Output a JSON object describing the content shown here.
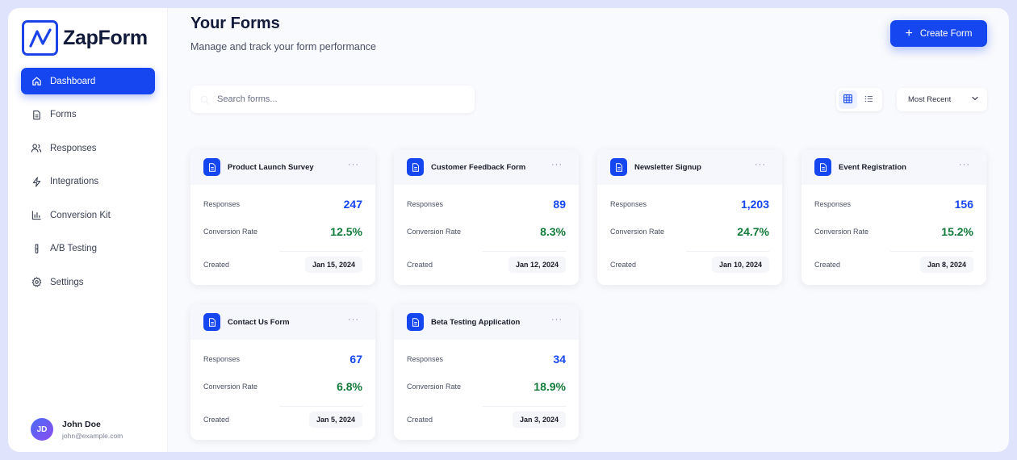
{
  "app": {
    "name": "ZapForm"
  },
  "nav": {
    "items": [
      {
        "label": "Dashboard",
        "icon": "home-icon",
        "active": true
      },
      {
        "label": "Forms",
        "icon": "file-icon"
      },
      {
        "label": "Responses",
        "icon": "users-icon"
      },
      {
        "label": "Integrations",
        "icon": "lightning-icon"
      },
      {
        "label": "Conversion Kit",
        "icon": "bar-chart-icon"
      },
      {
        "label": "A/B Testing",
        "icon": "test-tube-icon"
      },
      {
        "label": "Settings",
        "icon": "gear-icon"
      }
    ]
  },
  "user": {
    "initials": "JD",
    "name": "John Doe",
    "email": "john@example.com"
  },
  "header": {
    "title": "Your Forms",
    "subtitle": "Manage and track your form performance",
    "create_button": "Create Form"
  },
  "toolbar": {
    "search_placeholder": "Search forms...",
    "sort_value": "Most Recent",
    "view": "grid"
  },
  "labels": {
    "responses": "Responses",
    "conversion": "Conversion Rate",
    "created": "Created",
    "more": "···"
  },
  "forms": [
    {
      "title": "Product Launch Survey",
      "responses": "247",
      "conversion": "12.5%",
      "created": "Jan 15, 2024"
    },
    {
      "title": "Customer Feedback Form",
      "responses": "89",
      "conversion": "8.3%",
      "created": "Jan 12, 2024"
    },
    {
      "title": "Newsletter Signup",
      "responses": "1,203",
      "conversion": "24.7%",
      "created": "Jan 10, 2024"
    },
    {
      "title": "Event Registration",
      "responses": "156",
      "conversion": "15.2%",
      "created": "Jan 8, 2024"
    },
    {
      "title": "Contact Us Form",
      "responses": "67",
      "conversion": "6.8%",
      "created": "Jan 5, 2024"
    },
    {
      "title": "Beta Testing Application",
      "responses": "34",
      "conversion": "18.9%",
      "created": "Jan 3, 2024"
    }
  ],
  "colors": {
    "accent": "#1646f0",
    "positive": "#127a3a",
    "background": "#f9fafd"
  }
}
